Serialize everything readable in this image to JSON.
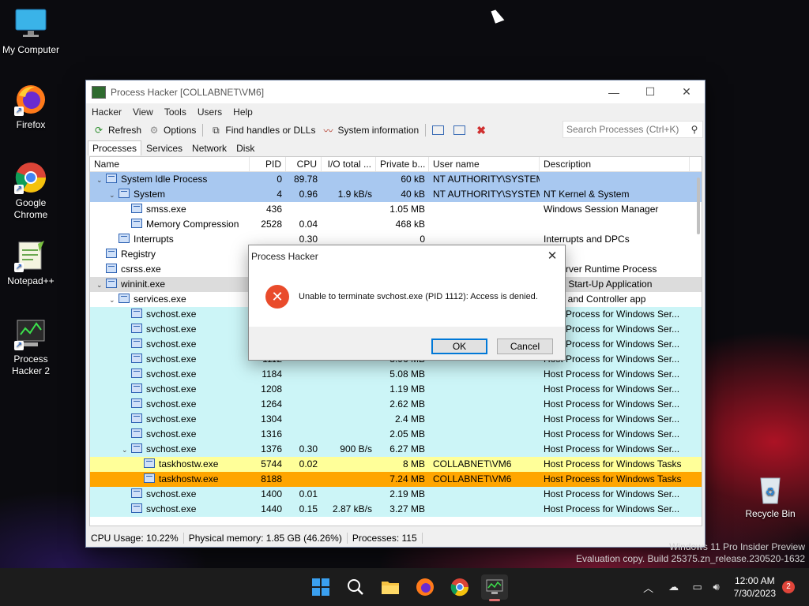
{
  "colors": {
    "system_row": "#a8c8f0",
    "service_row": "#ccf5f7",
    "own_process_row": "#ffff99",
    "selected_row": "#ffa500",
    "win_selected_row": "#dcdcdc"
  },
  "desktop": {
    "icons": [
      {
        "label": "My Computer",
        "icon": "monitor-icon"
      },
      {
        "label": "Firefox",
        "icon": "firefox-icon"
      },
      {
        "label": "Google Chrome",
        "icon": "chrome-icon"
      },
      {
        "label": "Notepad++",
        "icon": "notepadpp-icon"
      },
      {
        "label": "Process Hacker 2",
        "icon": "process-hacker-icon"
      },
      {
        "label": "Recycle Bin",
        "icon": "recycle-bin-icon"
      }
    ]
  },
  "window": {
    "title": "Process Hacker [COLLABNET\\VM6]",
    "menu": [
      "Hacker",
      "View",
      "Tools",
      "Users",
      "Help"
    ],
    "toolbar": {
      "refresh": "Refresh",
      "options": "Options",
      "find_handles": "Find handles or DLLs",
      "system_info": "System information"
    },
    "search_placeholder": "Search Processes (Ctrl+K)",
    "tabs": [
      "Processes",
      "Services",
      "Network",
      "Disk"
    ],
    "columns": [
      "Name",
      "PID",
      "CPU",
      "I/O total ...",
      "Private b...",
      "User name",
      "Description"
    ],
    "status": {
      "cpu": "CPU Usage: 10.22%",
      "memory": "Physical memory: 1.85 GB (46.26%)",
      "processes": "Processes: 115"
    }
  },
  "processes": [
    {
      "name": "System Idle Process",
      "pid": "0",
      "cpu": "89.78",
      "io": "",
      "priv": "60 kB",
      "user": "NT AUTHORITY\\SYSTEM",
      "desc": "",
      "level": 0,
      "expanded": true,
      "kind": "system"
    },
    {
      "name": "System",
      "pid": "4",
      "cpu": "0.96",
      "io": "1.9 kB/s",
      "priv": "40 kB",
      "user": "NT AUTHORITY\\SYSTEM",
      "desc": "NT Kernel & System",
      "level": 1,
      "expanded": true,
      "kind": "system"
    },
    {
      "name": "smss.exe",
      "pid": "436",
      "cpu": "",
      "io": "",
      "priv": "1.05 MB",
      "user": "",
      "desc": "Windows Session Manager",
      "level": 2,
      "kind": "normal"
    },
    {
      "name": "Memory Compression",
      "pid": "2528",
      "cpu": "0.04",
      "io": "",
      "priv": "468 kB",
      "user": "",
      "desc": "",
      "level": 2,
      "kind": "normal"
    },
    {
      "name": "Interrupts",
      "pid": "",
      "cpu": "0.30",
      "io": "",
      "priv": "0",
      "user": "",
      "desc": "Interrupts and DPCs",
      "level": 1,
      "kind": "normal"
    },
    {
      "name": "Registry",
      "pid": "",
      "cpu": "",
      "io": "",
      "priv": "",
      "user": "",
      "desc": "",
      "level": 0,
      "kind": "normal"
    },
    {
      "name": "csrss.exe",
      "pid": "",
      "cpu": "",
      "io": "",
      "priv": "",
      "user": "",
      "desc": "nt Server Runtime Process",
      "level": 0,
      "kind": "normal"
    },
    {
      "name": "wininit.exe",
      "pid": "",
      "cpu": "",
      "io": "",
      "priv": "",
      "user": "",
      "desc": "dows Start-Up Application",
      "level": 0,
      "expanded": true,
      "kind": "gray"
    },
    {
      "name": "services.exe",
      "pid": "",
      "cpu": "",
      "io": "",
      "priv": "",
      "user": "",
      "desc": "vices and Controller app",
      "level": 1,
      "expanded": true,
      "kind": "normal"
    },
    {
      "name": "svchost.exe",
      "pid": "",
      "cpu": "",
      "io": "",
      "priv": "",
      "user": "",
      "desc": "Host Process for Windows Ser...",
      "level": 2,
      "kind": "service"
    },
    {
      "name": "svchost.exe",
      "pid": "",
      "cpu": "",
      "io": "",
      "priv": "",
      "user": "",
      "desc": "Host Process for Windows Ser...",
      "level": 2,
      "kind": "service"
    },
    {
      "name": "svchost.exe",
      "pid": "",
      "cpu": "",
      "io": "",
      "priv": "",
      "user": "",
      "desc": "Host Process for Windows Ser...",
      "level": 2,
      "kind": "service"
    },
    {
      "name": "svchost.exe",
      "pid": "1112",
      "cpu": "",
      "io": "",
      "priv": "3.96 MB",
      "user": "",
      "desc": "Host Process for Windows Ser...",
      "level": 2,
      "kind": "service"
    },
    {
      "name": "svchost.exe",
      "pid": "1184",
      "cpu": "",
      "io": "",
      "priv": "5.08 MB",
      "user": "",
      "desc": "Host Process for Windows Ser...",
      "level": 2,
      "kind": "service"
    },
    {
      "name": "svchost.exe",
      "pid": "1208",
      "cpu": "",
      "io": "",
      "priv": "1.19 MB",
      "user": "",
      "desc": "Host Process for Windows Ser...",
      "level": 2,
      "kind": "service"
    },
    {
      "name": "svchost.exe",
      "pid": "1264",
      "cpu": "",
      "io": "",
      "priv": "2.62 MB",
      "user": "",
      "desc": "Host Process for Windows Ser...",
      "level": 2,
      "kind": "service"
    },
    {
      "name": "svchost.exe",
      "pid": "1304",
      "cpu": "",
      "io": "",
      "priv": "2.4 MB",
      "user": "",
      "desc": "Host Process for Windows Ser...",
      "level": 2,
      "kind": "service"
    },
    {
      "name": "svchost.exe",
      "pid": "1316",
      "cpu": "",
      "io": "",
      "priv": "2.05 MB",
      "user": "",
      "desc": "Host Process for Windows Ser...",
      "level": 2,
      "kind": "service"
    },
    {
      "name": "svchost.exe",
      "pid": "1376",
      "cpu": "0.30",
      "io": "900 B/s",
      "priv": "6.27 MB",
      "user": "",
      "desc": "Host Process for Windows Ser...",
      "level": 2,
      "expanded": true,
      "kind": "service"
    },
    {
      "name": "taskhostw.exe",
      "pid": "5744",
      "cpu": "0.02",
      "io": "",
      "priv": "8 MB",
      "user": "COLLABNET\\VM6",
      "desc": "Host Process for Windows Tasks",
      "level": 3,
      "kind": "own"
    },
    {
      "name": "taskhostw.exe",
      "pid": "8188",
      "cpu": "",
      "io": "",
      "priv": "7.24 MB",
      "user": "COLLABNET\\VM6",
      "desc": "Host Process for Windows Tasks",
      "level": 3,
      "kind": "selected"
    },
    {
      "name": "svchost.exe",
      "pid": "1400",
      "cpu": "0.01",
      "io": "",
      "priv": "2.19 MB",
      "user": "",
      "desc": "Host Process for Windows Ser...",
      "level": 2,
      "kind": "service"
    },
    {
      "name": "svchost.exe",
      "pid": "1440",
      "cpu": "0.15",
      "io": "2.87 kB/s",
      "priv": "3.27 MB",
      "user": "",
      "desc": "Host Process for Windows Ser...",
      "level": 2,
      "kind": "service"
    }
  ],
  "dialog": {
    "title": "Process Hacker",
    "message": "Unable to terminate svchost.exe (PID 1112): Access is denied.",
    "ok": "OK",
    "cancel": "Cancel"
  },
  "watermark": {
    "line1": "Windows 11 Pro Insider Preview",
    "line2": "Evaluation copy. Build 25375.zn_release.230520-1632"
  },
  "taskbar": {
    "time": "12:00 AM",
    "date": "7/30/2023",
    "notifications": "2"
  }
}
